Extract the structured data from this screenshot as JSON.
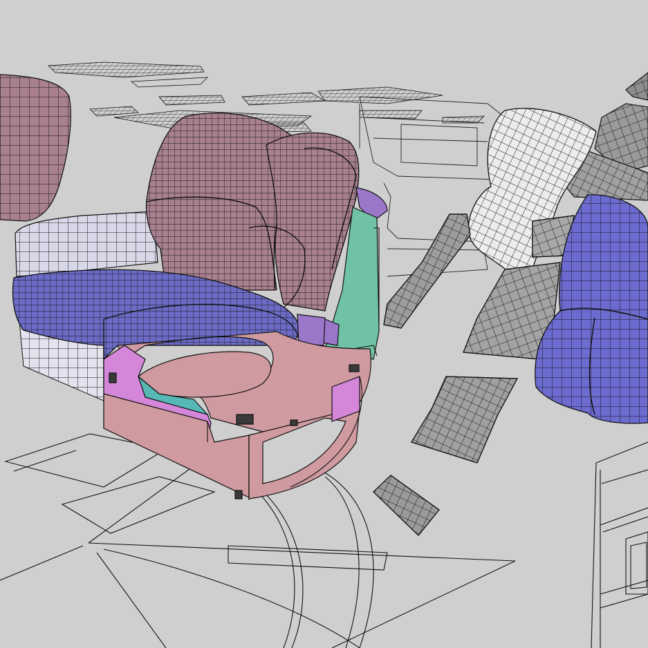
{
  "viewport": {
    "background": "#cfcfcf",
    "line_color": "#111111"
  },
  "materials": {
    "back_cushion": "#a8808f",
    "seat_cushion": "#6b6bc6",
    "arm_block": "#d8d8e8",
    "base_light": "#e4e2ee",
    "frame_pink": "#cf9aa0",
    "frame_magenta": "#d487d8",
    "frame_teal": "#6fc2a3",
    "frame_cyan": "#56b9b6",
    "frame_purple": "#9b77c9",
    "panel_white": "#ececec",
    "panel_grey": "#9d9d9d",
    "panel_blue": "#6b6bd0"
  }
}
